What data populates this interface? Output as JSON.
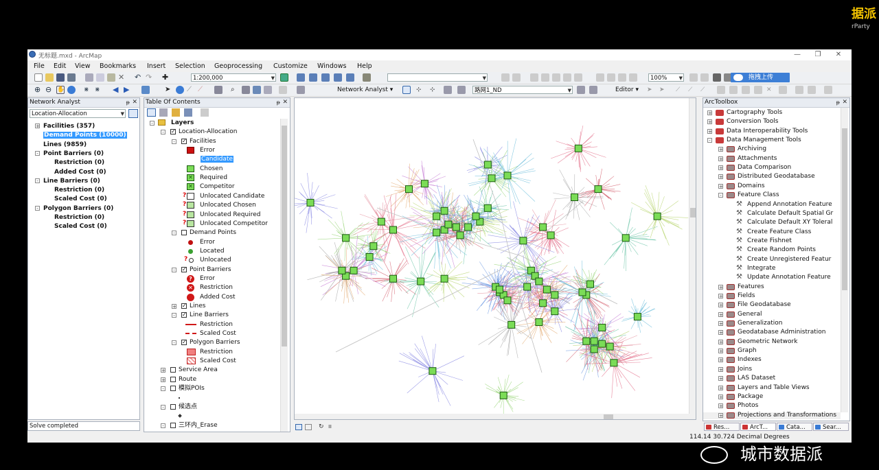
{
  "window": {
    "title": "无标题.mxd - ArcMap"
  },
  "watermark": {
    "top_right": "据派",
    "top_right_sub": "rParty",
    "bottom_right": "城市数据派"
  },
  "menu": [
    "File",
    "Edit",
    "View",
    "Bookmarks",
    "Insert",
    "Selection",
    "Geoprocessing",
    "Customize",
    "Windows",
    "Help"
  ],
  "toolbar": {
    "scale": "1:200,000",
    "zoom_percent": "100%",
    "network_analyst_label": "Network Analyst",
    "network_dataset": "路网1_ND",
    "editor_label": "Editor",
    "upload_button": "拖拽上传"
  },
  "network_analyst": {
    "header": "Network Analyst",
    "layer_select": "Location-Allocation",
    "items": [
      {
        "label": "Facilities (357)",
        "indent": 0,
        "expand": "+",
        "selected": false
      },
      {
        "label": "Demand Points (10000)",
        "indent": 0,
        "expand": "",
        "selected": true
      },
      {
        "label": "Lines (9859)",
        "indent": 0,
        "expand": "",
        "selected": false
      },
      {
        "label": "Point Barriers (0)",
        "indent": 0,
        "expand": "-",
        "selected": false
      },
      {
        "label": "Restriction (0)",
        "indent": 1,
        "expand": "",
        "selected": false
      },
      {
        "label": "Added Cost (0)",
        "indent": 1,
        "expand": "",
        "selected": false
      },
      {
        "label": "Line Barriers (0)",
        "indent": 0,
        "expand": "-",
        "selected": false
      },
      {
        "label": "Restriction (0)",
        "indent": 1,
        "expand": "",
        "selected": false
      },
      {
        "label": "Scaled Cost (0)",
        "indent": 1,
        "expand": "",
        "selected": false
      },
      {
        "label": "Polygon Barriers (0)",
        "indent": 0,
        "expand": "-",
        "selected": false
      },
      {
        "label": "Restriction (0)",
        "indent": 1,
        "expand": "",
        "selected": false
      },
      {
        "label": "Scaled Cost (0)",
        "indent": 1,
        "expand": "",
        "selected": false
      }
    ]
  },
  "toc": {
    "header": "Table Of Contents",
    "items": [
      {
        "label": "Layers",
        "x": 0,
        "expand": "-",
        "check": "",
        "sym": "layers",
        "bold": true
      },
      {
        "label": "Location-Allocation",
        "x": 1,
        "expand": "-",
        "check": "on",
        "sym": ""
      },
      {
        "label": "Facilities",
        "x": 2,
        "expand": "-",
        "check": "on",
        "sym": ""
      },
      {
        "label": "Error",
        "x": 3,
        "expand": "",
        "check": "",
        "sym": "sq-red"
      },
      {
        "label": "Candidate",
        "x": 3,
        "expand": "",
        "check": "",
        "sym": "",
        "selected": true
      },
      {
        "label": "Chosen",
        "x": 3,
        "expand": "",
        "check": "",
        "sym": "sq-green"
      },
      {
        "label": "Required",
        "x": 3,
        "expand": "",
        "check": "",
        "sym": "sq-green-x"
      },
      {
        "label": "Competitor",
        "x": 3,
        "expand": "",
        "check": "",
        "sym": "sq-green-x"
      },
      {
        "label": "Unlocated Candidate",
        "x": 3,
        "expand": "",
        "check": "",
        "sym": "q-sq-white"
      },
      {
        "label": "Unlocated Chosen",
        "x": 3,
        "expand": "",
        "check": "",
        "sym": "q-sq-green"
      },
      {
        "label": "Unlocated Required",
        "x": 3,
        "expand": "",
        "check": "",
        "sym": "q-sq-green"
      },
      {
        "label": "Unlocated Competitor",
        "x": 3,
        "expand": "",
        "check": "",
        "sym": "q-sq-green"
      },
      {
        "label": "Demand Points",
        "x": 2,
        "expand": "-",
        "check": "off",
        "sym": ""
      },
      {
        "label": "Error",
        "x": 3,
        "expand": "",
        "check": "",
        "sym": "dot-red"
      },
      {
        "label": "Located",
        "x": 3,
        "expand": "",
        "check": "",
        "sym": "dot-green"
      },
      {
        "label": "Unlocated",
        "x": 3,
        "expand": "",
        "check": "",
        "sym": "q-dot"
      },
      {
        "label": "Point Barriers",
        "x": 2,
        "expand": "-",
        "check": "on",
        "sym": ""
      },
      {
        "label": "Error",
        "x": 3,
        "expand": "",
        "check": "",
        "sym": "q-red-circle"
      },
      {
        "label": "Restriction",
        "x": 3,
        "expand": "",
        "check": "",
        "sym": "x-red-circle"
      },
      {
        "label": "Added Cost",
        "x": 3,
        "expand": "",
        "check": "",
        "sym": "dot-red-big"
      },
      {
        "label": "Lines",
        "x": 2,
        "expand": "+",
        "check": "on",
        "sym": ""
      },
      {
        "label": "Line Barriers",
        "x": 2,
        "expand": "-",
        "check": "on",
        "sym": ""
      },
      {
        "label": "Restriction",
        "x": 3,
        "expand": "",
        "check": "",
        "sym": "line-red"
      },
      {
        "label": "Scaled Cost",
        "x": 3,
        "expand": "",
        "check": "",
        "sym": "line-red-dash"
      },
      {
        "label": "Polygon Barriers",
        "x": 2,
        "expand": "-",
        "check": "on",
        "sym": ""
      },
      {
        "label": "Restriction",
        "x": 3,
        "expand": "",
        "check": "",
        "sym": "poly-red"
      },
      {
        "label": "Scaled Cost",
        "x": 3,
        "expand": "",
        "check": "",
        "sym": "poly-red-hatch"
      },
      {
        "label": "Service Area",
        "x": 1,
        "expand": "+",
        "check": "off",
        "sym": ""
      },
      {
        "label": "Route",
        "x": 1,
        "expand": "+",
        "check": "off",
        "sym": ""
      },
      {
        "label": "模拟POIs",
        "x": 1,
        "expand": "-",
        "check": "off",
        "sym": ""
      },
      {
        "label": "",
        "x": 2,
        "expand": "",
        "check": "",
        "sym": "tiny-dot"
      },
      {
        "label": "候选点",
        "x": 1,
        "expand": "-",
        "check": "off",
        "sym": ""
      },
      {
        "label": "",
        "x": 2,
        "expand": "",
        "check": "",
        "sym": "tiny-diamond"
      },
      {
        "label": "三环内_Erase",
        "x": 1,
        "expand": "-",
        "check": "off",
        "sym": ""
      }
    ]
  },
  "arctoolbox": {
    "header": "ArcToolbox",
    "items": [
      {
        "label": "Cartography Tools",
        "x": 0,
        "expand": "+",
        "kind": "box"
      },
      {
        "label": "Conversion Tools",
        "x": 0,
        "expand": "+",
        "kind": "box"
      },
      {
        "label": "Data Interoperability Tools",
        "x": 0,
        "expand": "+",
        "kind": "box"
      },
      {
        "label": "Data Management Tools",
        "x": 0,
        "expand": "-",
        "kind": "box"
      },
      {
        "label": "Archiving",
        "x": 1,
        "expand": "+",
        "kind": "set"
      },
      {
        "label": "Attachments",
        "x": 1,
        "expand": "+",
        "kind": "set"
      },
      {
        "label": "Data Comparison",
        "x": 1,
        "expand": "+",
        "kind": "set"
      },
      {
        "label": "Distributed Geodatabase",
        "x": 1,
        "expand": "+",
        "kind": "set"
      },
      {
        "label": "Domains",
        "x": 1,
        "expand": "+",
        "kind": "set"
      },
      {
        "label": "Feature Class",
        "x": 1,
        "expand": "-",
        "kind": "set"
      },
      {
        "label": "Append Annotation Feature",
        "x": 2,
        "expand": "",
        "kind": "tool"
      },
      {
        "label": "Calculate Default Spatial Gr",
        "x": 2,
        "expand": "",
        "kind": "tool"
      },
      {
        "label": "Calculate Default XY Toleral",
        "x": 2,
        "expand": "",
        "kind": "tool"
      },
      {
        "label": "Create Feature Class",
        "x": 2,
        "expand": "",
        "kind": "tool"
      },
      {
        "label": "Create Fishnet",
        "x": 2,
        "expand": "",
        "kind": "tool"
      },
      {
        "label": "Create Random Points",
        "x": 2,
        "expand": "",
        "kind": "tool"
      },
      {
        "label": "Create Unregistered Featur",
        "x": 2,
        "expand": "",
        "kind": "tool"
      },
      {
        "label": "Integrate",
        "x": 2,
        "expand": "",
        "kind": "tool"
      },
      {
        "label": "Update Annotation Feature",
        "x": 2,
        "expand": "",
        "kind": "tool"
      },
      {
        "label": "Features",
        "x": 1,
        "expand": "+",
        "kind": "set"
      },
      {
        "label": "Fields",
        "x": 1,
        "expand": "+",
        "kind": "set"
      },
      {
        "label": "File Geodatabase",
        "x": 1,
        "expand": "+",
        "kind": "set"
      },
      {
        "label": "General",
        "x": 1,
        "expand": "+",
        "kind": "set"
      },
      {
        "label": "Generalization",
        "x": 1,
        "expand": "+",
        "kind": "set"
      },
      {
        "label": "Geodatabase Administration",
        "x": 1,
        "expand": "+",
        "kind": "set"
      },
      {
        "label": "Geometric Network",
        "x": 1,
        "expand": "+",
        "kind": "set"
      },
      {
        "label": "Graph",
        "x": 1,
        "expand": "+",
        "kind": "set"
      },
      {
        "label": "Indexes",
        "x": 1,
        "expand": "+",
        "kind": "set"
      },
      {
        "label": "Joins",
        "x": 1,
        "expand": "+",
        "kind": "set"
      },
      {
        "label": "LAS Dataset",
        "x": 1,
        "expand": "+",
        "kind": "set"
      },
      {
        "label": "Layers and Table Views",
        "x": 1,
        "expand": "+",
        "kind": "set"
      },
      {
        "label": "Package",
        "x": 1,
        "expand": "+",
        "kind": "set"
      },
      {
        "label": "Photos",
        "x": 1,
        "expand": "+",
        "kind": "set"
      },
      {
        "label": "Projections and Transformations",
        "x": 1,
        "expand": "+",
        "kind": "set"
      }
    ]
  },
  "bottom_tabs": [
    "Res...",
    "ArcT...",
    "Cata...",
    "Sear..."
  ],
  "status": {
    "left": "Solve completed",
    "coords": "114.14",
    "coords2": "30.724 Decimal Degrees"
  },
  "colors": {
    "facility_fill": "#7bdc57",
    "facility_border": "#1a5a10",
    "error_red": "#d81818",
    "selection": "#3399ff"
  },
  "map": {
    "cluster_colors": [
      "#e0607e",
      "#7c7ce0",
      "#8ed06a",
      "#60b8d8",
      "#c070d0",
      "#e0a060",
      "#a0a0a0",
      "#d05060",
      "#60c0a0",
      "#b0d060",
      "#6090e0",
      "#e08090"
    ],
    "facilities": [
      [
        0.72,
        0.16
      ],
      [
        0.49,
        0.22
      ],
      [
        0.5,
        0.27
      ],
      [
        0.54,
        0.26
      ],
      [
        0.33,
        0.29
      ],
      [
        0.29,
        0.31
      ],
      [
        0.71,
        0.34
      ],
      [
        0.77,
        0.31
      ],
      [
        0.49,
        0.38
      ],
      [
        0.36,
        0.41
      ],
      [
        0.38,
        0.39
      ],
      [
        0.22,
        0.43
      ],
      [
        0.25,
        0.46
      ],
      [
        0.04,
        0.36
      ],
      [
        0.13,
        0.49
      ],
      [
        0.36,
        0.47
      ],
      [
        0.38,
        0.46
      ],
      [
        0.39,
        0.44
      ],
      [
        0.41,
        0.45
      ],
      [
        0.42,
        0.48
      ],
      [
        0.44,
        0.45
      ],
      [
        0.47,
        0.43
      ],
      [
        0.46,
        0.41
      ],
      [
        0.63,
        0.45
      ],
      [
        0.65,
        0.48
      ],
      [
        0.58,
        0.5
      ],
      [
        0.2,
        0.52
      ],
      [
        0.19,
        0.56
      ],
      [
        0.15,
        0.61
      ],
      [
        0.13,
        0.63
      ],
      [
        0.12,
        0.61
      ],
      [
        0.25,
        0.64
      ],
      [
        0.32,
        0.65
      ],
      [
        0.38,
        0.64
      ],
      [
        0.51,
        0.67
      ],
      [
        0.52,
        0.69
      ],
      [
        0.53,
        0.7
      ],
      [
        0.59,
        0.67
      ],
      [
        0.6,
        0.61
      ],
      [
        0.61,
        0.63
      ],
      [
        0.62,
        0.65
      ],
      [
        0.64,
        0.68
      ],
      [
        0.66,
        0.7
      ],
      [
        0.74,
        0.7
      ],
      [
        0.84,
        0.49
      ],
      [
        0.92,
        0.41
      ],
      [
        0.52,
        0.68
      ],
      [
        0.54,
        0.72
      ],
      [
        0.63,
        0.73
      ],
      [
        0.66,
        0.76
      ],
      [
        0.75,
        0.66
      ],
      [
        0.73,
        0.69
      ],
      [
        0.78,
        0.82
      ],
      [
        0.62,
        0.8
      ],
      [
        0.55,
        0.81
      ],
      [
        0.74,
        0.87
      ],
      [
        0.76,
        0.87
      ],
      [
        0.78,
        0.88
      ],
      [
        0.76,
        0.9
      ],
      [
        0.8,
        0.89
      ],
      [
        0.81,
        0.95
      ],
      [
        0.35,
        0.98
      ],
      [
        0.53,
        1.07
      ],
      [
        0.87,
        0.78
      ]
    ]
  }
}
